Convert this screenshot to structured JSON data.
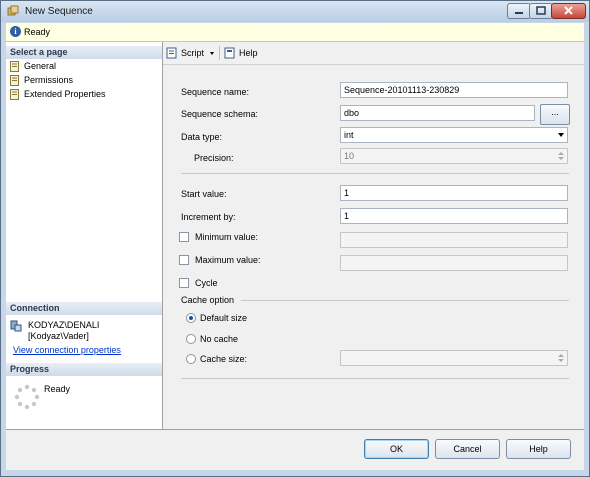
{
  "window": {
    "title": "New Sequence"
  },
  "status": {
    "text": "Ready"
  },
  "left": {
    "select_page_header": "Select a page",
    "pages": [
      {
        "label": "General",
        "icon": "page-icon"
      },
      {
        "label": "Permissions",
        "icon": "page-icon"
      },
      {
        "label": "Extended Properties",
        "icon": "page-icon"
      }
    ],
    "connection_header": "Connection",
    "server": "KODYAZ\\DENALI",
    "user": "[Kodyaz\\Vader]",
    "view_connection_link": "View connection properties",
    "progress_header": "Progress",
    "progress_status": "Ready"
  },
  "toolbar": {
    "script_label": "Script",
    "help_label": "Help"
  },
  "form": {
    "sequence_name_label": "Sequence name:",
    "sequence_name_value": "Sequence-20101113-230829",
    "schema_label": "Sequence schema:",
    "schema_value": "dbo",
    "schema_button": "...",
    "data_type_label": "Data type:",
    "data_type_value": "int",
    "precision_label": "Precision:",
    "precision_value": "10",
    "start_label": "Start value:",
    "start_value": "1",
    "increment_label": "Increment by:",
    "increment_value": "1",
    "min_label": "Minimum value:",
    "min_value": "",
    "max_label": "Maximum value:",
    "max_value": "",
    "cycle_label": "Cycle",
    "cache_option_label": "Cache option",
    "default_size_label": "Default size",
    "no_cache_label": "No cache",
    "cache_size_label": "Cache size:",
    "cache_size_value": "",
    "selected_cache_option": "Default size"
  },
  "buttons": {
    "ok": "OK",
    "cancel": "Cancel",
    "help": "Help"
  }
}
